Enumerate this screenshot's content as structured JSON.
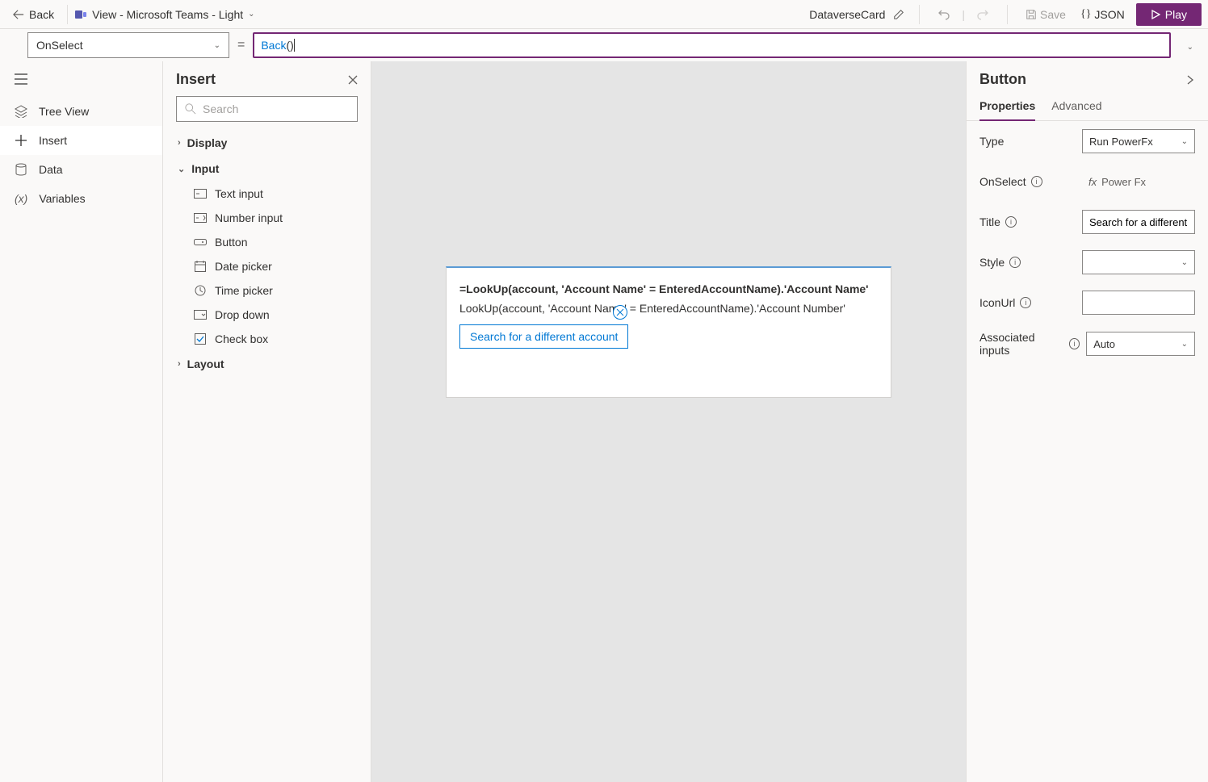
{
  "topbar": {
    "back_label": "Back",
    "view_label": "View - Microsoft Teams - Light",
    "card_name": "DataverseCard",
    "save_label": "Save",
    "json_label": "JSON",
    "play_label": "Play"
  },
  "formula": {
    "property": "OnSelect",
    "expression_fn": "Back",
    "expression_args": "()"
  },
  "rail": {
    "items": [
      {
        "label": "Tree View",
        "icon": "layers"
      },
      {
        "label": "Insert",
        "icon": "plus",
        "active": true
      },
      {
        "label": "Data",
        "icon": "cylinder"
      },
      {
        "label": "Variables",
        "icon": "var"
      }
    ]
  },
  "insert": {
    "title": "Insert",
    "search_placeholder": "Search",
    "categories": [
      {
        "name": "Display",
        "expanded": false
      },
      {
        "name": "Input",
        "expanded": true,
        "items": [
          {
            "label": "Text input",
            "icon": "text"
          },
          {
            "label": "Number input",
            "icon": "number"
          },
          {
            "label": "Button",
            "icon": "button"
          },
          {
            "label": "Date picker",
            "icon": "calendar"
          },
          {
            "label": "Time picker",
            "icon": "clock"
          },
          {
            "label": "Drop down",
            "icon": "dropdown"
          },
          {
            "label": "Check box",
            "icon": "checkbox"
          }
        ]
      },
      {
        "name": "Layout",
        "expanded": false
      }
    ]
  },
  "canvas": {
    "line1": "=LookUp(account, 'Account Name' = EnteredAccountName).'Account Name'",
    "line2": "LookUp(account, 'Account Name' = EnteredAccountName).'Account Number'",
    "button_label": "Search for a different account"
  },
  "props": {
    "panel_title": "Button",
    "tabs": {
      "properties": "Properties",
      "advanced": "Advanced"
    },
    "rows": {
      "type_label": "Type",
      "type_value": "Run PowerFx",
      "onselect_label": "OnSelect",
      "onselect_value": "Power Fx",
      "title_label": "Title",
      "title_value": "Search for a different account",
      "style_label": "Style",
      "style_value": "",
      "iconurl_label": "IconUrl",
      "iconurl_value": "",
      "assoc_label": "Associated inputs",
      "assoc_value": "Auto"
    }
  }
}
